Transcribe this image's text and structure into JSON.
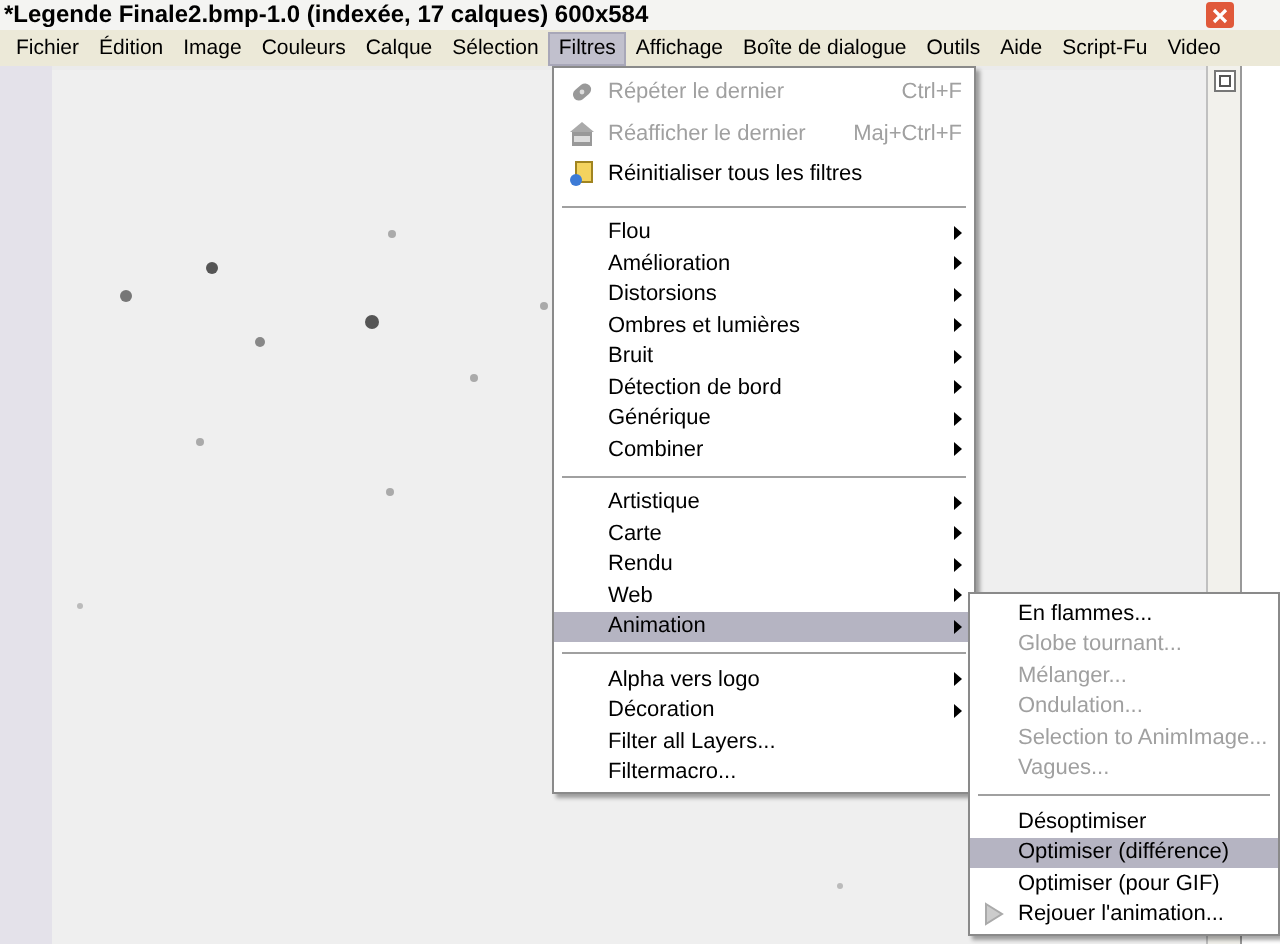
{
  "window": {
    "title": "*Legende Finale2.bmp-1.0 (indexée, 17 calques) 600x584"
  },
  "menubar": [
    {
      "label": "Fichier",
      "selected": false
    },
    {
      "label": "Édition",
      "selected": false
    },
    {
      "label": "Image",
      "selected": false
    },
    {
      "label": "Couleurs",
      "selected": false
    },
    {
      "label": "Calque",
      "selected": false
    },
    {
      "label": "Sélection",
      "selected": false
    },
    {
      "label": "Filtres",
      "selected": true
    },
    {
      "label": "Affichage",
      "selected": false
    },
    {
      "label": "Boîte de dialogue",
      "selected": false
    },
    {
      "label": "Outils",
      "selected": false
    },
    {
      "label": "Aide",
      "selected": false
    },
    {
      "label": "Script-Fu",
      "selected": false
    },
    {
      "label": "Video",
      "selected": false
    }
  ],
  "filters_menu": [
    {
      "kind": "icon_item",
      "label": "Répéter le dernier",
      "shortcut": "Ctrl+F",
      "disabled": true,
      "submenu": false,
      "selected": false
    },
    {
      "kind": "icon_item",
      "label": "Réafficher le dernier",
      "shortcut": "Maj+Ctrl+F",
      "disabled": true,
      "submenu": false,
      "selected": false
    },
    {
      "kind": "icon_item",
      "label": "Réinitialiser tous les filtres",
      "disabled": false,
      "submenu": false,
      "selected": false
    },
    {
      "kind": "separator"
    },
    {
      "kind": "item",
      "label": "Flou",
      "disabled": false,
      "submenu": true,
      "selected": false
    },
    {
      "kind": "item",
      "label": "Amélioration",
      "disabled": false,
      "submenu": true,
      "selected": false
    },
    {
      "kind": "item",
      "label": "Distorsions",
      "disabled": false,
      "submenu": true,
      "selected": false
    },
    {
      "kind": "item",
      "label": "Ombres et lumières",
      "disabled": false,
      "submenu": true,
      "selected": false
    },
    {
      "kind": "item",
      "label": "Bruit",
      "disabled": false,
      "submenu": true,
      "selected": false
    },
    {
      "kind": "item",
      "label": "Détection de bord",
      "disabled": false,
      "submenu": true,
      "selected": false
    },
    {
      "kind": "item",
      "label": "Générique",
      "disabled": false,
      "submenu": true,
      "selected": false
    },
    {
      "kind": "item",
      "label": "Combiner",
      "disabled": false,
      "submenu": true,
      "selected": false
    },
    {
      "kind": "separator"
    },
    {
      "kind": "item",
      "label": "Artistique",
      "disabled": false,
      "submenu": true,
      "selected": false
    },
    {
      "kind": "item",
      "label": "Carte",
      "disabled": false,
      "submenu": true,
      "selected": false
    },
    {
      "kind": "item",
      "label": "Rendu",
      "disabled": false,
      "submenu": true,
      "selected": false
    },
    {
      "kind": "item",
      "label": "Web",
      "disabled": false,
      "submenu": true,
      "selected": false
    },
    {
      "kind": "item",
      "label": "Animation",
      "disabled": false,
      "submenu": true,
      "selected": true
    },
    {
      "kind": "separator"
    },
    {
      "kind": "item",
      "label": "Alpha vers logo",
      "disabled": false,
      "submenu": true,
      "selected": false
    },
    {
      "kind": "item",
      "label": "Décoration",
      "disabled": false,
      "submenu": true,
      "selected": false
    },
    {
      "kind": "item",
      "label": "Filter all Layers...",
      "disabled": false,
      "submenu": false,
      "selected": false
    },
    {
      "kind": "item",
      "label": "Filtermacro...",
      "disabled": false,
      "submenu": false,
      "selected": false
    }
  ],
  "animation_submenu": [
    {
      "kind": "item",
      "label": "En flammes...",
      "disabled": false,
      "selected": false
    },
    {
      "kind": "item",
      "label": "Globe tournant...",
      "disabled": true,
      "selected": false
    },
    {
      "kind": "item",
      "label": "Mélanger...",
      "disabled": true,
      "selected": false
    },
    {
      "kind": "item",
      "label": "Ondulation...",
      "disabled": true,
      "selected": false
    },
    {
      "kind": "item",
      "label": "Selection to AnimImage...",
      "disabled": true,
      "selected": false
    },
    {
      "kind": "item",
      "label": "Vagues...",
      "disabled": true,
      "selected": false
    },
    {
      "kind": "separator"
    },
    {
      "kind": "item",
      "label": "Désoptimiser",
      "disabled": false,
      "selected": false
    },
    {
      "kind": "item",
      "label": "Optimiser (différence)",
      "disabled": false,
      "selected": true
    },
    {
      "kind": "item",
      "label": "Optimiser (pour GIF)",
      "disabled": false,
      "selected": false
    },
    {
      "kind": "icon_item",
      "label": "Rejouer l'animation...",
      "disabled": false,
      "selected": false
    }
  ]
}
